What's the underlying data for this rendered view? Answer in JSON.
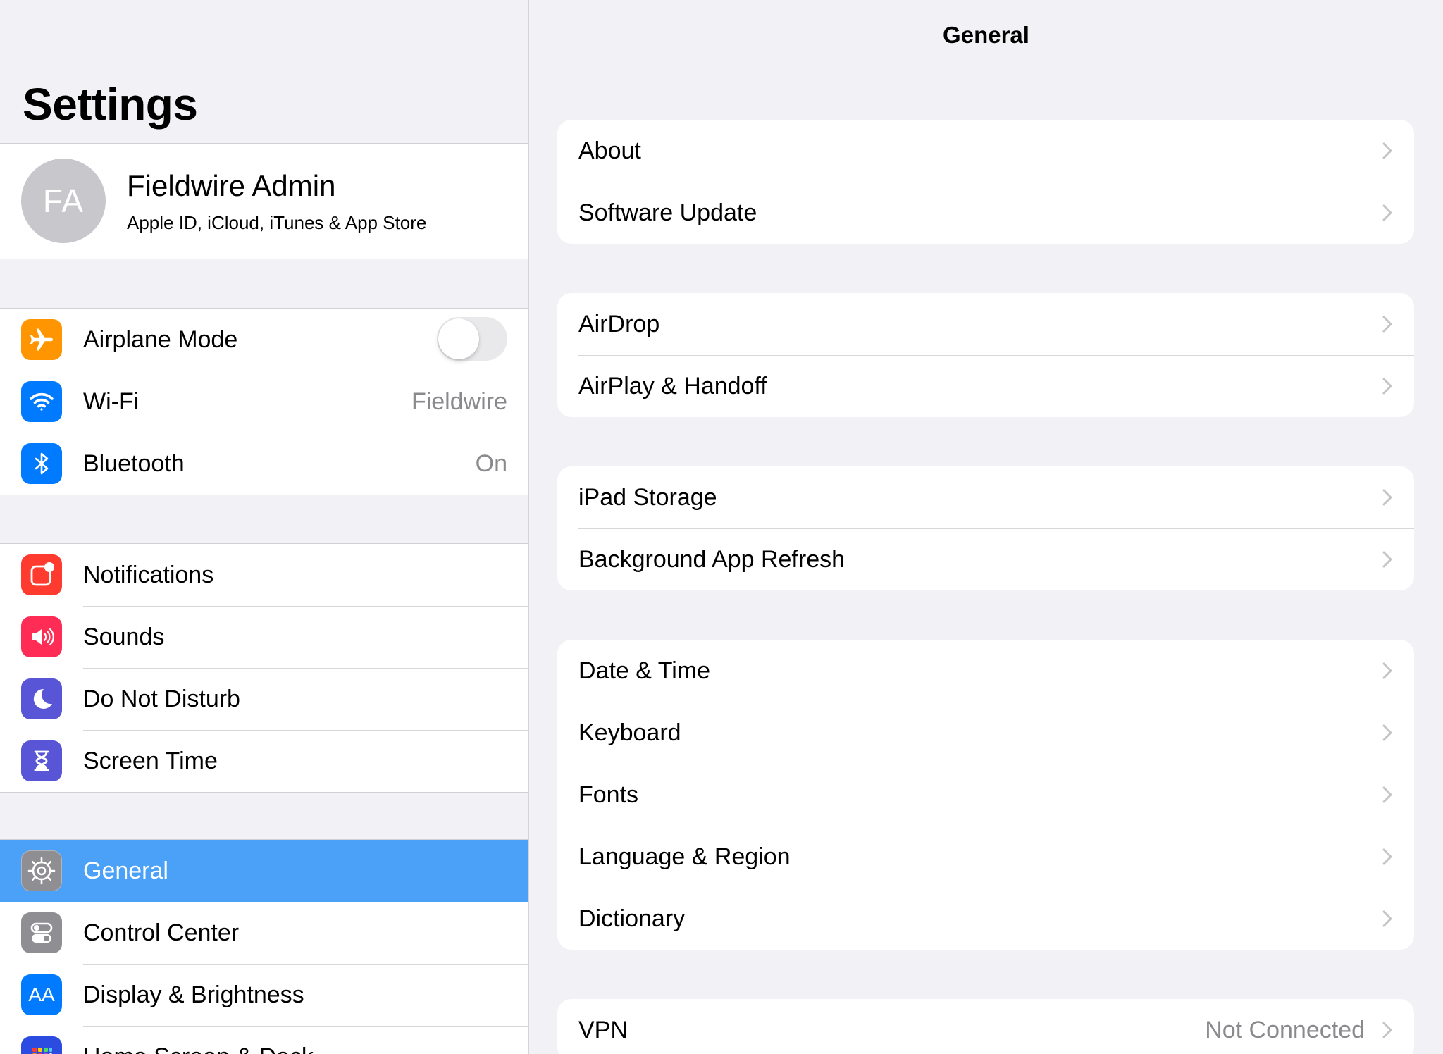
{
  "sidebar": {
    "title": "Settings",
    "profile": {
      "initials": "FA",
      "name": "Fieldwire Admin",
      "subtitle": "Apple ID, iCloud, iTunes & App Store"
    },
    "group1": [
      {
        "label": "Airplane Mode",
        "icon": "airplane-icon",
        "color": "#ff9500",
        "toggle": false
      },
      {
        "label": "Wi-Fi",
        "icon": "wifi-icon",
        "color": "#007aff",
        "value": "Fieldwire"
      },
      {
        "label": "Bluetooth",
        "icon": "bluetooth-icon",
        "color": "#007aff",
        "value": "On"
      }
    ],
    "group2": [
      {
        "label": "Notifications",
        "icon": "notifications-icon",
        "color": "#ff3b30"
      },
      {
        "label": "Sounds",
        "icon": "sounds-icon",
        "color": "#ff2d55"
      },
      {
        "label": "Do Not Disturb",
        "icon": "moon-icon",
        "color": "#5856d6"
      },
      {
        "label": "Screen Time",
        "icon": "hourglass-icon",
        "color": "#5856d6"
      }
    ],
    "group3": [
      {
        "label": "General",
        "icon": "gear-icon",
        "color": "#8e8e93",
        "selected": true
      },
      {
        "label": "Control Center",
        "icon": "switches-icon",
        "color": "#8e8e93"
      },
      {
        "label": "Display & Brightness",
        "icon": "text-size-icon",
        "color": "#007aff",
        "glyph": "AA"
      },
      {
        "label": "Home Screen & Dock",
        "icon": "home-screen-icon",
        "color": "#2c4be0"
      }
    ]
  },
  "detail": {
    "title": "General",
    "groups": [
      [
        {
          "label": "About"
        },
        {
          "label": "Software Update"
        }
      ],
      [
        {
          "label": "AirDrop"
        },
        {
          "label": "AirPlay & Handoff"
        }
      ],
      [
        {
          "label": "iPad Storage"
        },
        {
          "label": "Background App Refresh"
        }
      ],
      [
        {
          "label": "Date & Time"
        },
        {
          "label": "Keyboard"
        },
        {
          "label": "Fonts"
        },
        {
          "label": "Language & Region"
        },
        {
          "label": "Dictionary"
        }
      ],
      [
        {
          "label": "VPN",
          "value": "Not Connected"
        }
      ]
    ]
  },
  "colors": {
    "selected_row": "#4ba1f7",
    "background": "#f1f1f6",
    "secondary_text": "#8a8a8e"
  }
}
